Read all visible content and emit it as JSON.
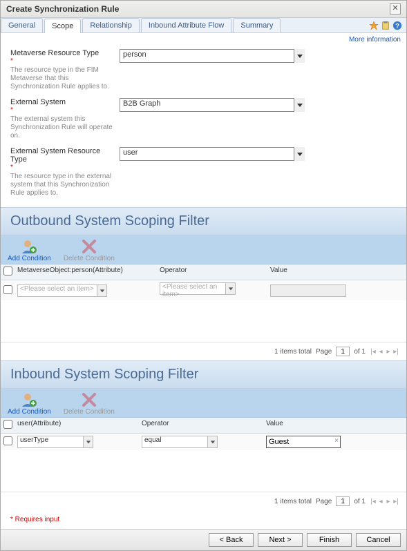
{
  "dialog": {
    "title": "Create Synchronization Rule"
  },
  "tabs": {
    "general": "General",
    "scope": "Scope",
    "relationship": "Relationship",
    "inboundFlow": "Inbound Attribute Flow",
    "summary": "Summary"
  },
  "moreInfo": "More information",
  "fields": {
    "mvResType": {
      "label": "Metaverse Resource Type",
      "desc": "The resource type in the FIM Metaverse that this Synchronization Rule applies to.",
      "value": "person"
    },
    "extSystem": {
      "label": "External System",
      "desc": "The external system this Synchronization Rule will operate on.",
      "value": "B2B Graph"
    },
    "extResType": {
      "label": "External System Resource Type",
      "desc": "The resource type in the external system that this Synchronization Rule applies to.",
      "value": "user"
    }
  },
  "outbound": {
    "title": "Outbound System Scoping Filter",
    "addLabel": "Add Condition",
    "deleteLabel": "Delete Condition",
    "headers": {
      "attr": "MetaverseObject:person(Attribute)",
      "op": "Operator",
      "val": "Value"
    },
    "row": {
      "attrPlaceholder": "<Please select an item>",
      "opPlaceholder": "<Please select an item>",
      "val": ""
    },
    "pager": {
      "total": "1 items total",
      "pageLabel": "Page",
      "page": "1",
      "of": "of 1"
    }
  },
  "inbound": {
    "title": "Inbound System Scoping Filter",
    "addLabel": "Add Condition",
    "deleteLabel": "Delete Condition",
    "headers": {
      "attr": "user(Attribute)",
      "op": "Operator",
      "val": "Value"
    },
    "row": {
      "attr": "userType",
      "op": "equal",
      "val": "Guest"
    },
    "pager": {
      "total": "1 items total",
      "pageLabel": "Page",
      "page": "1",
      "of": "of 1"
    }
  },
  "requiresNote": "* Requires input",
  "buttons": {
    "back": "< Back",
    "next": "Next >",
    "finish": "Finish",
    "cancel": "Cancel"
  }
}
